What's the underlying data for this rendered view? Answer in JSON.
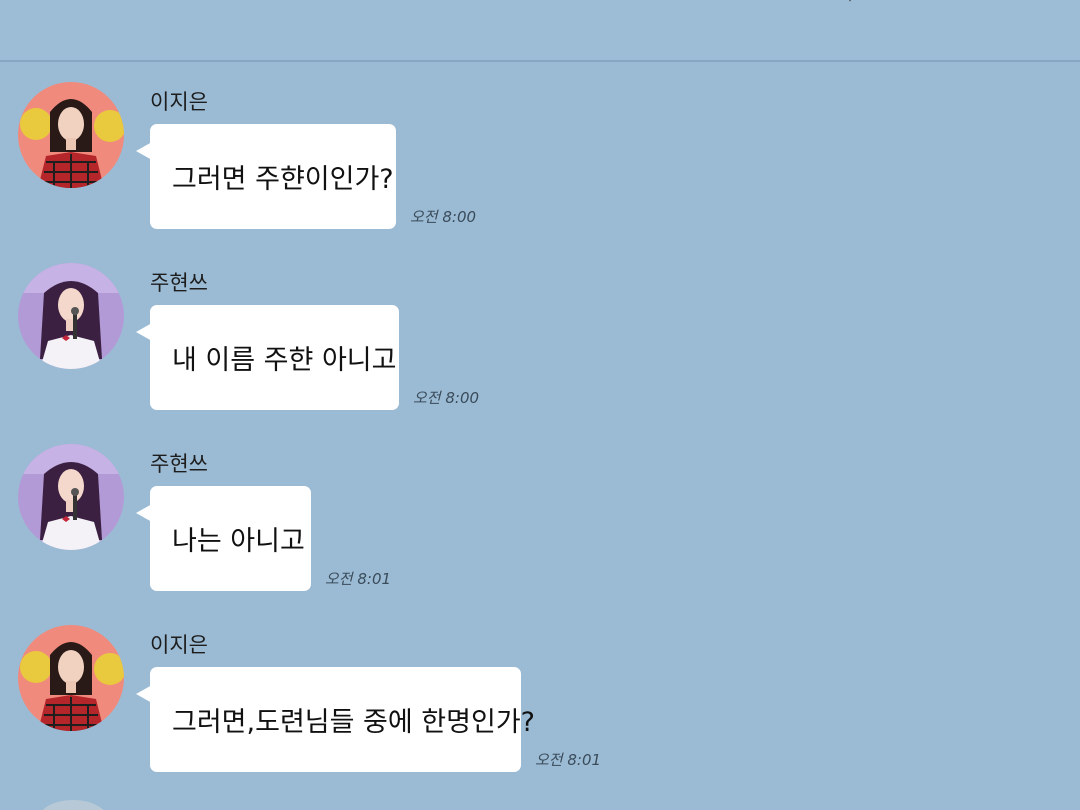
{
  "messages": [
    {
      "sender": "이지은",
      "text": "그러면 주햔이인가?",
      "time": "오전 8:00",
      "avatar": "avatar-iu-icon"
    },
    {
      "sender": "주현쓰",
      "text": "내 이름 주햔 아니고",
      "time": "오전 8:00",
      "avatar": "avatar-joohyun-icon"
    },
    {
      "sender": "주현쓰",
      "text": "나는 아니고",
      "time": "오전 8:01",
      "avatar": "avatar-joohyun-icon"
    },
    {
      "sender": "이지은",
      "text": "그러면,도련님들 중에 한명인가?",
      "time": "오전 8:01",
      "avatar": "avatar-iu-icon"
    }
  ],
  "colors": {
    "background": "#9bbbd4",
    "bubble": "#ffffff"
  }
}
